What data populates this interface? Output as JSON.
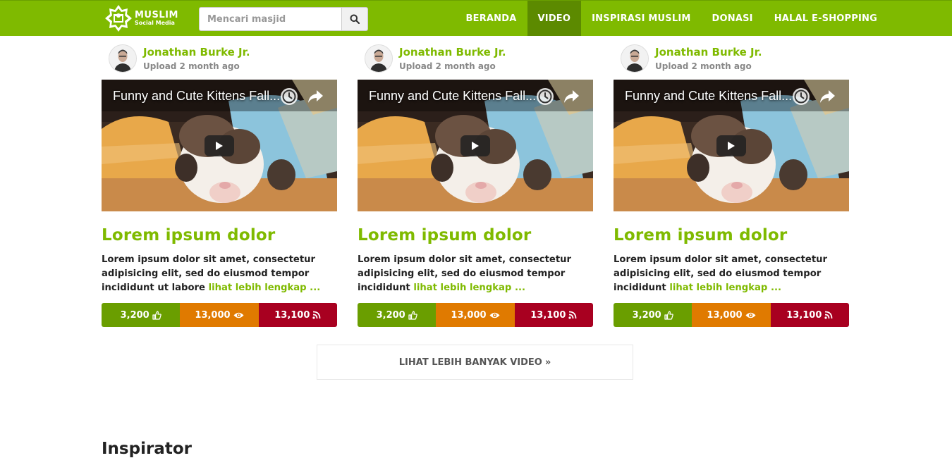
{
  "brand": {
    "line1": "MUSLIM",
    "line2": "Social Media"
  },
  "search": {
    "placeholder": "Mencari masjid"
  },
  "nav": [
    "BERANDA",
    "VIDEO",
    "INSPIRASI MUSLIM",
    "DONASI",
    "HALAL E-SHOPPING"
  ],
  "nav_active": "VIDEO",
  "cards": [
    {
      "author": "Jonathan Burke Jr.",
      "upload": "Upload 2 month ago",
      "video_title": "Funny and Cute Kittens Fall...",
      "title": "Lorem ipsum dolor",
      "text": "Lorem ipsum dolor sit amet, consectetur adipisicing elit, sed do eiusmod tempor incididunt ut labore",
      "more": "lihat lebih lengkap ...",
      "likes": "3,200",
      "views": "13,000",
      "rss": "13,100"
    },
    {
      "author": "Jonathan Burke Jr.",
      "upload": "Upload 2 month ago",
      "video_title": "Funny and Cute Kittens Fall...",
      "title": "Lorem ipsum dolor",
      "text": "Lorem ipsum dolor sit amet, consectetur adipisicing elit, sed do eiusmod tempor incididunt",
      "more": "lihat lebih lengkap ...",
      "likes": "3,200",
      "views": "13,000",
      "rss": "13,100"
    },
    {
      "author": "Jonathan Burke Jr.",
      "upload": "Upload 2 month ago",
      "video_title": "Funny and Cute Kittens Fall...",
      "title": "Lorem ipsum dolor",
      "text": "Lorem ipsum dolor sit amet, consectetur adipisicing elit, sed do eiusmod tempor incididunt",
      "more": "lihat lebih lengkap ...",
      "likes": "3,200",
      "views": "13,000",
      "rss": "13,100"
    }
  ],
  "more_button": "LIHAT LEBIH BANYAK VIDEO",
  "section_title": "Inspirator",
  "colors": {
    "brand": "#7fba00",
    "nav_active": "#5c8a00",
    "likes": "#6a9e00",
    "views": "#e07a00",
    "rss": "#a80020"
  },
  "icons": {
    "search": "search-icon",
    "like": "thumbs-up-icon",
    "view": "eye-icon",
    "rss": "rss-icon",
    "clock": "clock-icon",
    "share": "share-icon",
    "play": "play-icon"
  }
}
